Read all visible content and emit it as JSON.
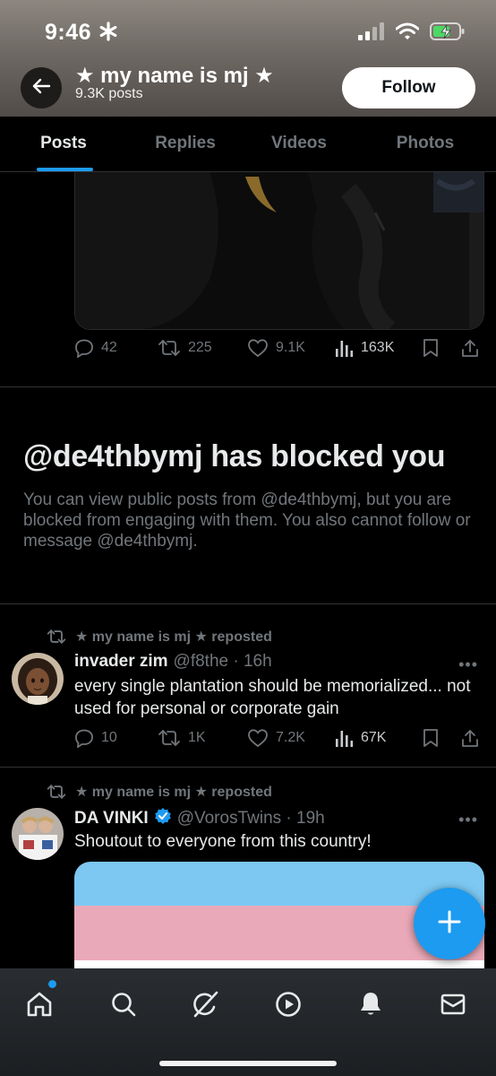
{
  "status_bar": {
    "time": "9:46"
  },
  "header": {
    "profile_name": "★ my name is mj ★",
    "post_count": "9.3K posts",
    "follow_label": "Follow"
  },
  "tabs": [
    {
      "label": "Posts",
      "active": true
    },
    {
      "label": "Replies",
      "active": false
    },
    {
      "label": "Videos",
      "active": false
    },
    {
      "label": "Photos",
      "active": false
    }
  ],
  "first_post": {
    "replies": "42",
    "reposts": "225",
    "likes": "9.1K",
    "views": "163K"
  },
  "blocked_notice": {
    "title": "@de4thbymj has blocked you",
    "body": "You can view public posts from @de4thbymj, but you are blocked from engaging with them. You also cannot follow or message @de4thbymj."
  },
  "posts": [
    {
      "repost_label": "★ my name is mj ★ reposted",
      "name": "invader zim",
      "handle": "@f8the · 16h",
      "verified": false,
      "text": "every single plantation should be memorialized... not used for personal or corporate gain",
      "replies": "10",
      "reposts": "1K",
      "likes": "7.2K",
      "views": "67K"
    },
    {
      "repost_label": "★ my name is mj ★ reposted",
      "name": "DA VINKI",
      "handle": "@VorosTwins · 19h",
      "verified": true,
      "text": "Shoutout to everyone from this country!"
    }
  ],
  "more_glyph": "•••",
  "colors": {
    "accent": "#1d9bf0",
    "background": "#000000",
    "muted_text": "#71767b",
    "flag_blue": "#7cc8f2",
    "flag_pink": "#eaa9b8",
    "flag_white": "#ffffff"
  },
  "bottom_nav": [
    "home-icon",
    "search-icon",
    "grok-icon",
    "video-icon",
    "notifications-icon",
    "messages-icon"
  ]
}
